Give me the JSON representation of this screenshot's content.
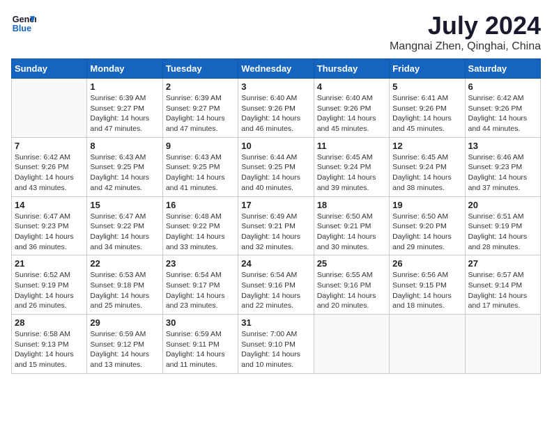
{
  "header": {
    "logo_line1": "General",
    "logo_line2": "Blue",
    "month": "July 2024",
    "location": "Mangnai Zhen, Qinghai, China"
  },
  "weekdays": [
    "Sunday",
    "Monday",
    "Tuesday",
    "Wednesday",
    "Thursday",
    "Friday",
    "Saturday"
  ],
  "weeks": [
    [
      {
        "day": "",
        "info": ""
      },
      {
        "day": "1",
        "info": "Sunrise: 6:39 AM\nSunset: 9:27 PM\nDaylight: 14 hours\nand 47 minutes."
      },
      {
        "day": "2",
        "info": "Sunrise: 6:39 AM\nSunset: 9:27 PM\nDaylight: 14 hours\nand 47 minutes."
      },
      {
        "day": "3",
        "info": "Sunrise: 6:40 AM\nSunset: 9:26 PM\nDaylight: 14 hours\nand 46 minutes."
      },
      {
        "day": "4",
        "info": "Sunrise: 6:40 AM\nSunset: 9:26 PM\nDaylight: 14 hours\nand 45 minutes."
      },
      {
        "day": "5",
        "info": "Sunrise: 6:41 AM\nSunset: 9:26 PM\nDaylight: 14 hours\nand 45 minutes."
      },
      {
        "day": "6",
        "info": "Sunrise: 6:42 AM\nSunset: 9:26 PM\nDaylight: 14 hours\nand 44 minutes."
      }
    ],
    [
      {
        "day": "7",
        "info": "Sunrise: 6:42 AM\nSunset: 9:26 PM\nDaylight: 14 hours\nand 43 minutes."
      },
      {
        "day": "8",
        "info": "Sunrise: 6:43 AM\nSunset: 9:25 PM\nDaylight: 14 hours\nand 42 minutes."
      },
      {
        "day": "9",
        "info": "Sunrise: 6:43 AM\nSunset: 9:25 PM\nDaylight: 14 hours\nand 41 minutes."
      },
      {
        "day": "10",
        "info": "Sunrise: 6:44 AM\nSunset: 9:25 PM\nDaylight: 14 hours\nand 40 minutes."
      },
      {
        "day": "11",
        "info": "Sunrise: 6:45 AM\nSunset: 9:24 PM\nDaylight: 14 hours\nand 39 minutes."
      },
      {
        "day": "12",
        "info": "Sunrise: 6:45 AM\nSunset: 9:24 PM\nDaylight: 14 hours\nand 38 minutes."
      },
      {
        "day": "13",
        "info": "Sunrise: 6:46 AM\nSunset: 9:23 PM\nDaylight: 14 hours\nand 37 minutes."
      }
    ],
    [
      {
        "day": "14",
        "info": "Sunrise: 6:47 AM\nSunset: 9:23 PM\nDaylight: 14 hours\nand 36 minutes."
      },
      {
        "day": "15",
        "info": "Sunrise: 6:47 AM\nSunset: 9:22 PM\nDaylight: 14 hours\nand 34 minutes."
      },
      {
        "day": "16",
        "info": "Sunrise: 6:48 AM\nSunset: 9:22 PM\nDaylight: 14 hours\nand 33 minutes."
      },
      {
        "day": "17",
        "info": "Sunrise: 6:49 AM\nSunset: 9:21 PM\nDaylight: 14 hours\nand 32 minutes."
      },
      {
        "day": "18",
        "info": "Sunrise: 6:50 AM\nSunset: 9:21 PM\nDaylight: 14 hours\nand 30 minutes."
      },
      {
        "day": "19",
        "info": "Sunrise: 6:50 AM\nSunset: 9:20 PM\nDaylight: 14 hours\nand 29 minutes."
      },
      {
        "day": "20",
        "info": "Sunrise: 6:51 AM\nSunset: 9:19 PM\nDaylight: 14 hours\nand 28 minutes."
      }
    ],
    [
      {
        "day": "21",
        "info": "Sunrise: 6:52 AM\nSunset: 9:19 PM\nDaylight: 14 hours\nand 26 minutes."
      },
      {
        "day": "22",
        "info": "Sunrise: 6:53 AM\nSunset: 9:18 PM\nDaylight: 14 hours\nand 25 minutes."
      },
      {
        "day": "23",
        "info": "Sunrise: 6:54 AM\nSunset: 9:17 PM\nDaylight: 14 hours\nand 23 minutes."
      },
      {
        "day": "24",
        "info": "Sunrise: 6:54 AM\nSunset: 9:16 PM\nDaylight: 14 hours\nand 22 minutes."
      },
      {
        "day": "25",
        "info": "Sunrise: 6:55 AM\nSunset: 9:16 PM\nDaylight: 14 hours\nand 20 minutes."
      },
      {
        "day": "26",
        "info": "Sunrise: 6:56 AM\nSunset: 9:15 PM\nDaylight: 14 hours\nand 18 minutes."
      },
      {
        "day": "27",
        "info": "Sunrise: 6:57 AM\nSunset: 9:14 PM\nDaylight: 14 hours\nand 17 minutes."
      }
    ],
    [
      {
        "day": "28",
        "info": "Sunrise: 6:58 AM\nSunset: 9:13 PM\nDaylight: 14 hours\nand 15 minutes."
      },
      {
        "day": "29",
        "info": "Sunrise: 6:59 AM\nSunset: 9:12 PM\nDaylight: 14 hours\nand 13 minutes."
      },
      {
        "day": "30",
        "info": "Sunrise: 6:59 AM\nSunset: 9:11 PM\nDaylight: 14 hours\nand 11 minutes."
      },
      {
        "day": "31",
        "info": "Sunrise: 7:00 AM\nSunset: 9:10 PM\nDaylight: 14 hours\nand 10 minutes."
      },
      {
        "day": "",
        "info": ""
      },
      {
        "day": "",
        "info": ""
      },
      {
        "day": "",
        "info": ""
      }
    ]
  ]
}
